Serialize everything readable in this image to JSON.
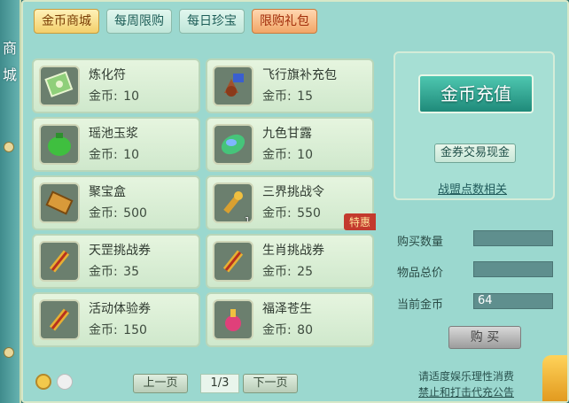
{
  "sidebar": {
    "title": "商城"
  },
  "tabs": [
    {
      "label": "金币商城"
    },
    {
      "label": "每周限购"
    },
    {
      "label": "每日珍宝"
    },
    {
      "label": "限购礼包"
    }
  ],
  "currency_label": "金币:",
  "items": [
    {
      "name": "炼化符",
      "price": "10",
      "icon": "talisman-icon"
    },
    {
      "name": "飞行旗补充包",
      "price": "15",
      "icon": "flag-bag-icon"
    },
    {
      "name": "瑶池玉浆",
      "price": "10",
      "icon": "green-jar-icon"
    },
    {
      "name": "九色甘露",
      "price": "10",
      "icon": "rainbow-gem-icon"
    },
    {
      "name": "聚宝盒",
      "price": "500",
      "icon": "treasure-box-icon"
    },
    {
      "name": "三界挑战令",
      "price": "550",
      "icon": "token-icon",
      "count": "1",
      "badge": "特惠"
    },
    {
      "name": "天罡挑战券",
      "price": "35",
      "icon": "scroll-icon"
    },
    {
      "name": "生肖挑战券",
      "price": "25",
      "icon": "scroll-icon"
    },
    {
      "name": "活动体验券",
      "price": "150",
      "icon": "scroll-icon"
    },
    {
      "name": "福泽苍生",
      "price": "80",
      "icon": "potion-icon"
    }
  ],
  "right": {
    "recharge_label": "金币充值",
    "exchange_label": "金券交易现金",
    "guild_link": "战盟点数相关",
    "quantity_label": "购买数量",
    "quantity_value": "",
    "total_label": "物品总价",
    "total_value": "",
    "current_label": "当前金币",
    "current_value": "64",
    "buy_label": "购 买"
  },
  "pagination": {
    "prev_label": "上一页",
    "page": "1/3",
    "next_label": "下一页"
  },
  "notices": {
    "line1": "请适度娱乐理性消费",
    "line2": "禁止和打击代充公告"
  },
  "colors": {
    "panel": "#9bd8cf",
    "active_tab": "#f3cf6a",
    "recharge": "#1f8a7a",
    "badge": "#c33a2e"
  }
}
